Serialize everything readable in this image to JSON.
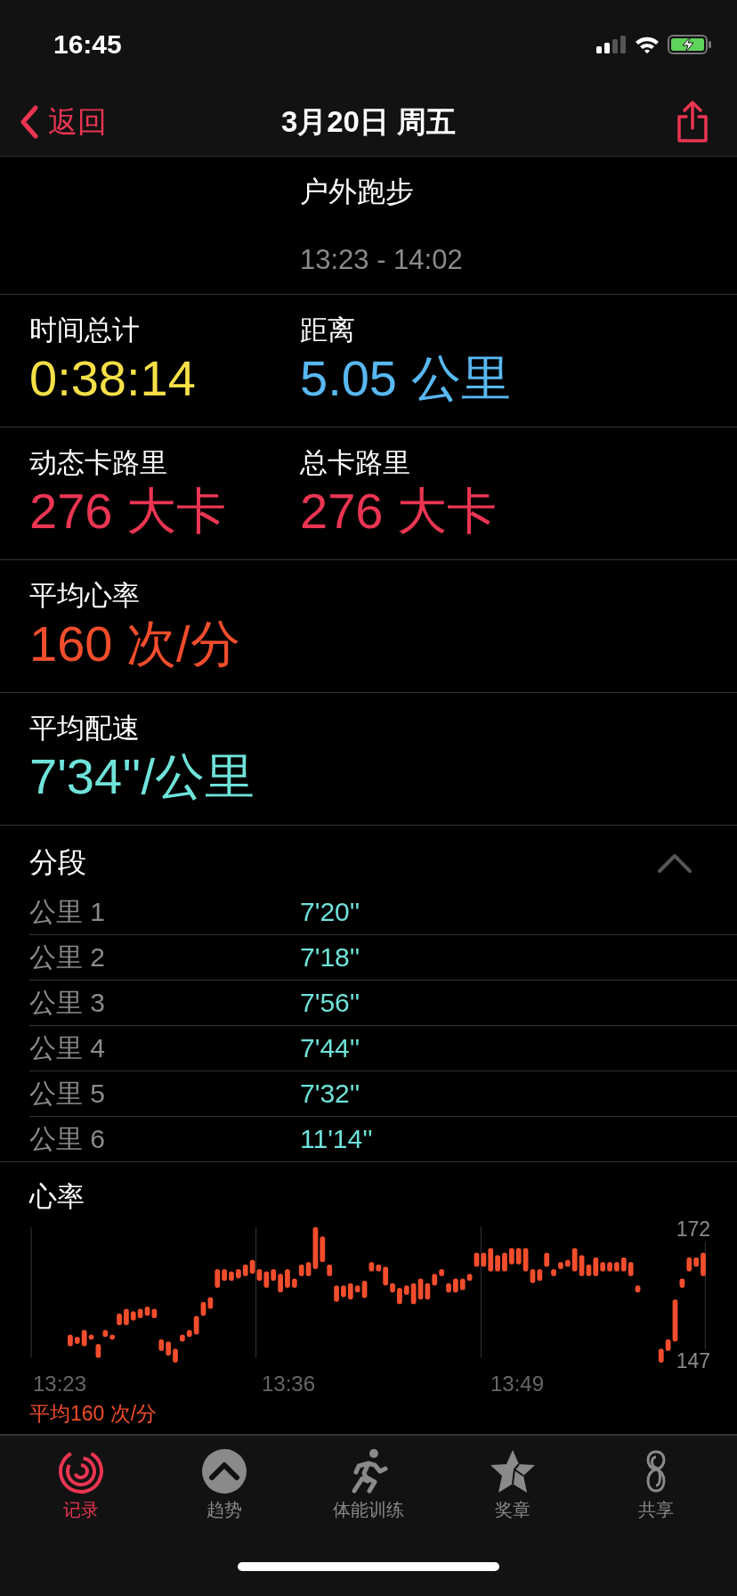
{
  "status_bar": {
    "time": "16:45"
  },
  "nav": {
    "back": "返回",
    "title": "3月20日 周五"
  },
  "workout": {
    "name": "户外跑步",
    "time_range": "13:23 - 14:02"
  },
  "metric_rows": [
    [
      {
        "label": "时间总计",
        "value": "0:38:14",
        "color": "#f7e047"
      },
      {
        "label": "距离",
        "value": "5.05 公里",
        "color": "#58b8f2"
      }
    ],
    [
      {
        "label": "动态卡路里",
        "value": "276 大卡",
        "color": "#ea3552"
      },
      {
        "label": "总卡路里",
        "value": "276 大卡",
        "color": "#ea3552"
      }
    ],
    [
      {
        "label": "平均心率",
        "value": "160 次/分",
        "color": "#f24d2c"
      }
    ],
    [
      {
        "label": "平均配速",
        "value": "7'34''/公里",
        "color": "#6fe3da"
      }
    ]
  ],
  "splits": {
    "title": "分段",
    "expanded": true,
    "rows": [
      {
        "label": "公里 1",
        "pace": "7'20''"
      },
      {
        "label": "公里 2",
        "pace": "7'18''"
      },
      {
        "label": "公里 3",
        "pace": "7'56''"
      },
      {
        "label": "公里 4",
        "pace": "7'44''"
      },
      {
        "label": "公里 5",
        "pace": "7'32''"
      },
      {
        "label": "公里 6",
        "pace": "11'14''"
      }
    ]
  },
  "heart_rate": {
    "title": "心率",
    "y_max": "172",
    "y_min": "147",
    "times": [
      "13:23",
      "13:36",
      "13:49"
    ],
    "average": "平均160 次/分"
  },
  "tabs": [
    {
      "label": "记录",
      "selected": true
    },
    {
      "label": "趋势",
      "selected": false
    },
    {
      "label": "体能训练",
      "selected": false
    },
    {
      "label": "奖章",
      "selected": false
    },
    {
      "label": "共享",
      "selected": false
    }
  ]
}
